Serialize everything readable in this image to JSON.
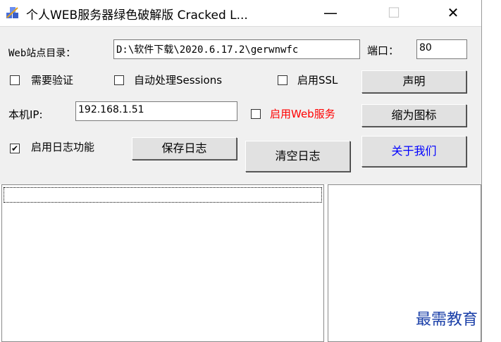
{
  "window": {
    "title": "个人WEB服务器绿色破解版 Cracked L...",
    "minimize_glyph": "—",
    "maximize_glyph": "☐",
    "close_glyph": "✕"
  },
  "form": {
    "web_root_label": "Web站点目录：",
    "web_root_value": "D:\\软件下载\\2020.6.17.2\\gerwnwfc",
    "port_label": "端口：",
    "port_value": "80",
    "require_auth_label": "需要验证",
    "auto_sessions_label": "自动处理Sessions",
    "enable_ssl_label": "启用SSL",
    "statement_button": "声明",
    "local_ip_label": "本机IP:",
    "local_ip_value": "192.168.1.51",
    "enable_web_label": "启用Web服务",
    "enable_web_color": "#ff0000",
    "minimize_icon_button": "缩为图标",
    "enable_log_label": "启用日志功能",
    "enable_log_checked_mark": "✔",
    "save_log_button": "保存日志",
    "clear_log_button": "清空日志",
    "about_button": "关于我们",
    "about_color": "#0000ff"
  },
  "watermark": "最需教育"
}
